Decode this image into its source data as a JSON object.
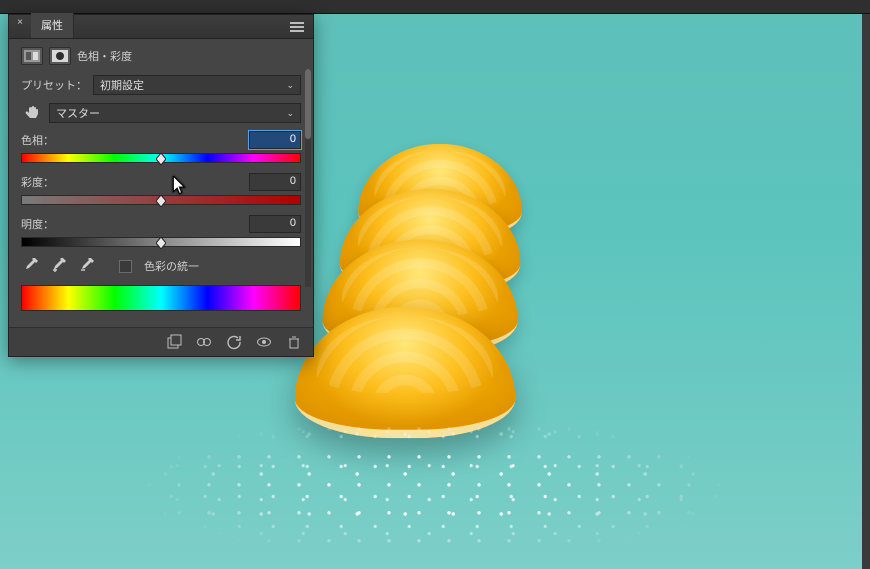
{
  "panel": {
    "title_tab": "属性",
    "adjustment_type": "色相・彩度",
    "preset_label": "プリセット：",
    "preset_value": "初期設定",
    "channel_value": "マスター",
    "hue": {
      "label": "色相：",
      "value": "0"
    },
    "saturation": {
      "label": "彩度：",
      "value": "0"
    },
    "lightness": {
      "label": "明度：",
      "value": "0"
    },
    "colorize_label": "色彩の統一"
  },
  "icons": {
    "close": "×",
    "menu": "menu",
    "chevron": "⌄",
    "hand": "☟"
  }
}
